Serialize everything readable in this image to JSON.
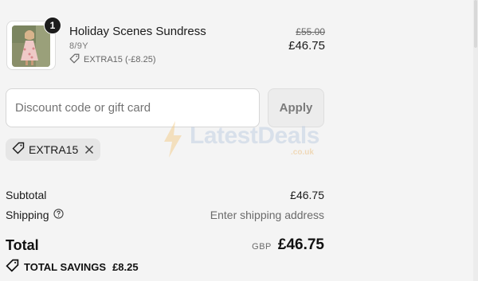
{
  "line_item": {
    "quantity": "1",
    "title": "Holiday Scenes Sundress",
    "variant": "8/9Y",
    "discount": "EXTRA15 (-£8.25)",
    "original_price": "£55.00",
    "price": "£46.75",
    "thumbnail_icon": "dress-photo"
  },
  "discount": {
    "placeholder": "Discount code or gift card",
    "apply_label": "Apply",
    "applied_code": "EXTRA15"
  },
  "watermark": {
    "brand": "LatestDeals",
    "domain": ".co.uk"
  },
  "summary": {
    "subtotal_label": "Subtotal",
    "subtotal_value": "£46.75",
    "shipping_label": "Shipping",
    "shipping_value": "Enter shipping address",
    "total_label": "Total",
    "currency": "GBP",
    "total_value": "£46.75",
    "savings_label": "TOTAL SAVINGS",
    "savings_value": "£8.25"
  },
  "colors": {
    "background": "#f4f4f4",
    "text": "#1a1a1a",
    "muted": "#737373"
  }
}
